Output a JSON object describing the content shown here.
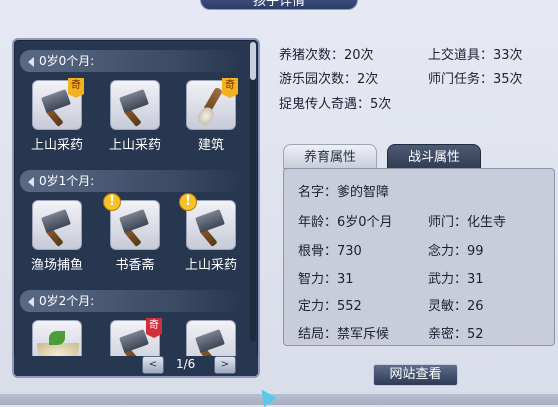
{
  "window": {
    "title": "孩子详情"
  },
  "left": {
    "groups": [
      {
        "title": "0岁0个月:",
        "items": [
          {
            "label": "上山采药",
            "icon": "hammer-icon",
            "badge": "奇",
            "badge_color": "orange"
          },
          {
            "label": "上山采药",
            "icon": "hammer-icon",
            "badge": "",
            "badge_color": ""
          },
          {
            "label": "建筑",
            "icon": "brush-icon",
            "badge": "奇",
            "badge_color": "orange"
          }
        ]
      },
      {
        "title": "0岁1个月:",
        "items": [
          {
            "label": "渔场捕鱼",
            "icon": "hammer-icon",
            "badge": "",
            "badge_color": ""
          },
          {
            "label": "书香斋",
            "icon": "hammer-icon",
            "badge": "!",
            "badge_color": "warn"
          },
          {
            "label": "上山采药",
            "icon": "hammer-icon",
            "badge": "!",
            "badge_color": "warn"
          }
        ]
      },
      {
        "title": "0岁2个月:",
        "items": [
          {
            "label": "",
            "icon": "bowl-icon",
            "badge": "",
            "badge_color": ""
          },
          {
            "label": "",
            "icon": "hammer-icon",
            "badge": "奇",
            "badge_color": "red"
          },
          {
            "label": "",
            "icon": "hammer-icon",
            "badge": "",
            "badge_color": ""
          }
        ]
      }
    ],
    "pager": {
      "prev": "<",
      "next": ">",
      "page": "1/6"
    }
  },
  "stats": {
    "pig": "养猪次数：20次",
    "items": "上交道具：33次",
    "park": "游乐园次数：2次",
    "school": "师门任务：35次",
    "ghost": "捉鬼传人奇遇：5次"
  },
  "tabs": {
    "inactive": "养育属性",
    "active": "战斗属性"
  },
  "info": {
    "name": "名字：爹的智障",
    "age": "年龄：6岁0个月",
    "sect": "师门：化生寺",
    "bone": "根骨：730",
    "mind": "念力：99",
    "intellect": "智力：31",
    "force": "武力：31",
    "focus": "定力：552",
    "agility": "灵敏：26",
    "ending": "结局：禁军斥候",
    "intimacy": "亲密：52"
  },
  "buttons": {
    "website": "网站查看"
  },
  "colors": {
    "panel": "#27374f",
    "badge_gold": "#f3b21f",
    "badge_red": "#d0303a",
    "tab_active": "#323d52"
  }
}
